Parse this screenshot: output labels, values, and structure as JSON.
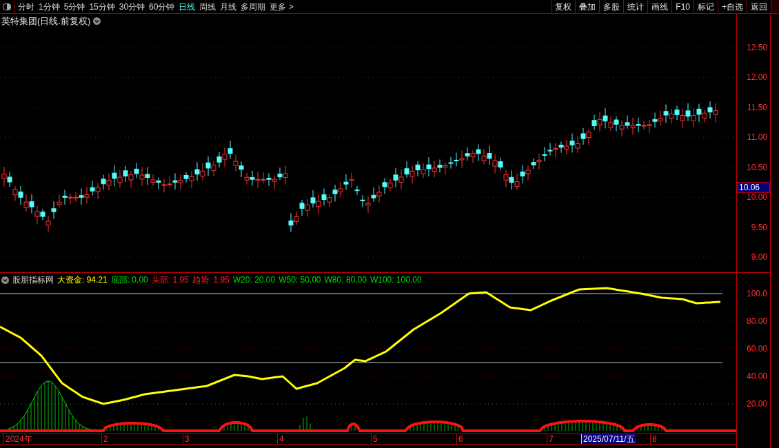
{
  "toolbar": {
    "periods": [
      {
        "label": "分时",
        "selected": false
      },
      {
        "label": "1分钟",
        "selected": false
      },
      {
        "label": "5分钟",
        "selected": false
      },
      {
        "label": "15分钟",
        "selected": false
      },
      {
        "label": "30分钟",
        "selected": false
      },
      {
        "label": "60分钟",
        "selected": false
      },
      {
        "label": "日线",
        "selected": true
      },
      {
        "label": "周线",
        "selected": false
      },
      {
        "label": "月线",
        "selected": false
      },
      {
        "label": "多周期",
        "selected": false
      },
      {
        "label": "更多 >",
        "selected": false
      }
    ],
    "buttons": [
      "复权",
      "叠加",
      "多股",
      "统计",
      "画线",
      "F10",
      "标记",
      "+自选",
      "返回"
    ]
  },
  "price_panel": {
    "title": "英特集团(日线.前复权)",
    "y_axis": [
      "12.50",
      "12.00",
      "11.50",
      "11.00",
      "10.50",
      "10.00",
      "9.50",
      "9.00"
    ],
    "cursor_price": "10.06"
  },
  "indicator_panel": {
    "name": "股朋指标网",
    "legend": [
      {
        "text": "大资金: 94.21",
        "color": "#ffff00"
      },
      {
        "text": "底部: 0.00",
        "color": "#00e000"
      },
      {
        "text": "头部: 1.95",
        "color": "#ff2020"
      },
      {
        "text": "趋势: 1.95",
        "color": "#ff2020"
      },
      {
        "text": "W20: 20.00",
        "color": "#00e000"
      },
      {
        "text": "W50: 50.00",
        "color": "#00e000"
      },
      {
        "text": "W80: 80.00",
        "color": "#00e000"
      },
      {
        "text": "W100: 100.00",
        "color": "#00e000"
      }
    ],
    "y_axis": [
      "100.0",
      "80.00",
      "60.00",
      "40.00",
      "20.00"
    ]
  },
  "date_axis": [
    {
      "label": "2024年",
      "selected": false
    },
    {
      "label": "2",
      "selected": false
    },
    {
      "label": "3",
      "selected": false
    },
    {
      "label": "4",
      "selected": false
    },
    {
      "label": "5",
      "selected": false
    },
    {
      "label": "6",
      "selected": false
    },
    {
      "label": "7",
      "selected": false
    },
    {
      "label": "2025/07/11/五",
      "selected": true
    },
    {
      "label": "8",
      "selected": false
    }
  ]
}
